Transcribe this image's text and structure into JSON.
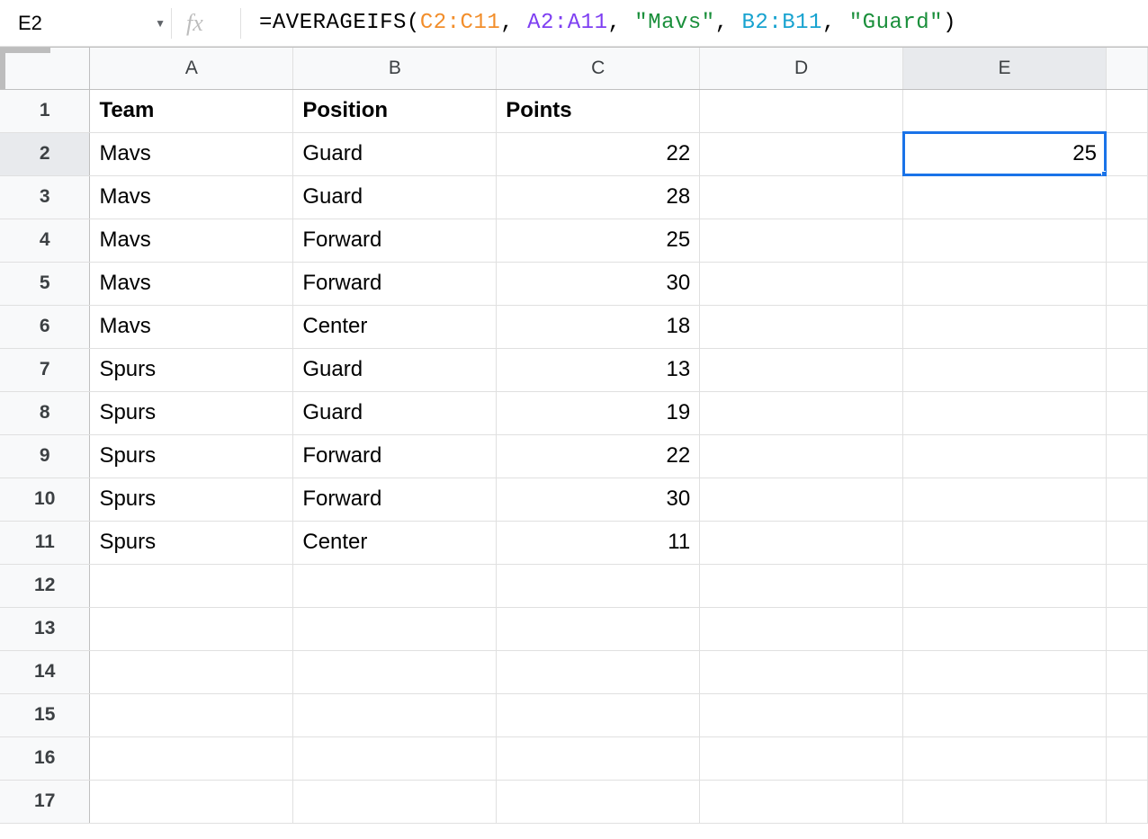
{
  "nameBox": {
    "value": "E2"
  },
  "fxLabel": "fx",
  "formula": {
    "tokens": [
      {
        "t": "=AVERAGEIFS(",
        "c": "tok-black"
      },
      {
        "t": "C2:C11",
        "c": "tok-orange"
      },
      {
        "t": ", ",
        "c": "tok-black"
      },
      {
        "t": "A2:A11",
        "c": "tok-purple"
      },
      {
        "t": ", ",
        "c": "tok-black"
      },
      {
        "t": "\"Mavs\"",
        "c": "tok-green"
      },
      {
        "t": ", ",
        "c": "tok-black"
      },
      {
        "t": "B2:B11",
        "c": "tok-cyan"
      },
      {
        "t": ", ",
        "c": "tok-black"
      },
      {
        "t": "\"Guard\"",
        "c": "tok-green"
      },
      {
        "t": ")",
        "c": "tok-black"
      }
    ]
  },
  "columns": [
    "A",
    "B",
    "C",
    "D",
    "E"
  ],
  "rowCount": 17,
  "selected": {
    "row": 2,
    "col": "E"
  },
  "headers": {
    "A": "Team",
    "B": "Position",
    "C": "Points"
  },
  "data": [
    {
      "A": "Mavs",
      "B": "Guard",
      "C": 22
    },
    {
      "A": "Mavs",
      "B": "Guard",
      "C": 28
    },
    {
      "A": "Mavs",
      "B": "Forward",
      "C": 25
    },
    {
      "A": "Mavs",
      "B": "Forward",
      "C": 30
    },
    {
      "A": "Mavs",
      "B": "Center",
      "C": 18
    },
    {
      "A": "Spurs",
      "B": "Guard",
      "C": 13
    },
    {
      "A": "Spurs",
      "B": "Guard",
      "C": 19
    },
    {
      "A": "Spurs",
      "B": "Forward",
      "C": 22
    },
    {
      "A": "Spurs",
      "B": "Forward",
      "C": 30
    },
    {
      "A": "Spurs",
      "B": "Center",
      "C": 11
    }
  ],
  "resultCell": {
    "row": 2,
    "col": "E",
    "value": 25
  }
}
